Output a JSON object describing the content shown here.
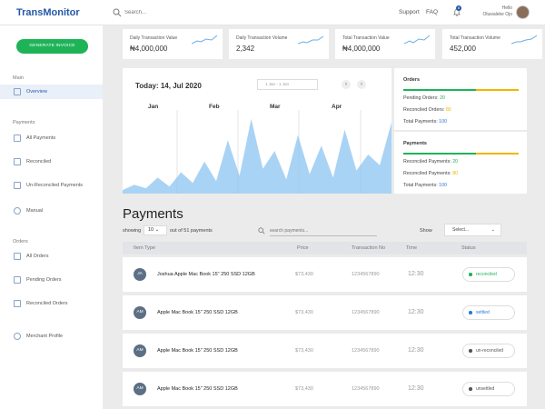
{
  "app": {
    "name": "TransMonitor"
  },
  "header": {
    "search_placeholder": "Search...",
    "support": "Support",
    "faq": "FAQ",
    "notifications_count": "8",
    "greeting": "Hello",
    "user_name": "Oluwaleke Ojo"
  },
  "sidebar": {
    "generate_button": "GENERATE INVOICE",
    "sections": [
      {
        "heading": "Main",
        "items": [
          {
            "label": "Overview",
            "icon": "overview-icon",
            "active": true
          }
        ]
      },
      {
        "heading": "Payments",
        "items": [
          {
            "label": "All Payments",
            "icon": "all-payments-icon"
          },
          {
            "label": "Reconciled",
            "icon": "reconciled-icon"
          },
          {
            "label": "Un-Reconciled Payments",
            "icon": "unreconciled-icon"
          },
          {
            "label": "Manual",
            "icon": "manual-icon"
          }
        ]
      },
      {
        "heading": "Orders",
        "items": [
          {
            "label": "All Orders",
            "icon": "all-orders-icon"
          },
          {
            "label": "Pending Orders",
            "icon": "pending-orders-icon"
          },
          {
            "label": "Reconciled Orders",
            "icon": "reconciled-orders-icon"
          },
          {
            "label": "Merchant Profile",
            "icon": "merchant-profile-icon"
          }
        ]
      }
    ]
  },
  "stats": [
    {
      "title": "Daily Transaction Value",
      "value": "₦4,000,000"
    },
    {
      "title": "Daily Transaction Volume",
      "value": "2,342"
    },
    {
      "title": "Total Transaction Value",
      "value": "₦4,000,000"
    },
    {
      "title": "Total Transaction Volume",
      "value": "452,000"
    }
  ],
  "chart": {
    "today_label": "Today: 14, Jul 2020",
    "date_range": "1 Jan - 1 Jun",
    "months": [
      "Jan",
      "Feb",
      "Mar",
      "Apr"
    ],
    "prev_label": "‹",
    "next_label": "›"
  },
  "chart_data": {
    "type": "area",
    "x": [
      "Jan",
      "Feb",
      "Mar",
      "Apr"
    ],
    "series": [
      {
        "values": [
          2,
          5,
          3,
          9,
          4,
          12,
          6,
          18,
          7,
          30,
          10,
          42,
          14,
          24,
          8,
          33,
          11,
          27,
          9,
          36,
          13,
          22,
          16,
          40
        ]
      }
    ],
    "color": "#8cc4f2"
  },
  "orders_panel": {
    "title": "Orders",
    "pending_label": "Pending Orders:",
    "pending_value": "20",
    "reconciled_label": "Reconciled Orders:",
    "reconciled_value": "80",
    "total_label": "Total Payments:",
    "total_value": "100"
  },
  "payments_panel": {
    "title": "Payments",
    "reconciled_label": "Reconciled Payments:",
    "reconciled_value": "20",
    "unreconciled_label": "Reconciled Payments:",
    "unreconciled_value": "80",
    "total_label": "Total Payments:",
    "total_value": "100"
  },
  "payments": {
    "title": "Payments",
    "showing_label": "showing",
    "page_size": "10",
    "out_of": "out of 51 payments",
    "search_placeholder": "search payments...",
    "show_label": "Show",
    "show_select": "Select...",
    "columns": [
      "Item Type",
      "Price",
      "Transaction No",
      "Time",
      "Status"
    ],
    "rows": [
      {
        "initials": "JA",
        "name": "Joshua Apple Mac Book 15\" 250 SSD 12GB",
        "price": "$73,430",
        "txn": "1234567890",
        "time": "12:30",
        "status": "reconciled",
        "status_color": "#1fb358"
      },
      {
        "initials": "AM",
        "name": "Apple Mac Book 15\" 250 SSD 12GB",
        "price": "$73,430",
        "txn": "1234567890",
        "time": "12:30",
        "status": "settled",
        "status_color": "#2a7ad6"
      },
      {
        "initials": "AM",
        "name": "Apple Mac Book 15\" 250 SSD 12GB",
        "price": "$73,430",
        "txn": "1234567890",
        "time": "12:30",
        "status": "un-reconciled",
        "status_color": "#555555"
      },
      {
        "initials": "AM",
        "name": "Apple Mac Book 15\" 250 SSD 12GB",
        "price": "$73,430",
        "txn": "1234567890",
        "time": "12:30",
        "status": "unsettled",
        "status_color": "#555555"
      }
    ]
  }
}
